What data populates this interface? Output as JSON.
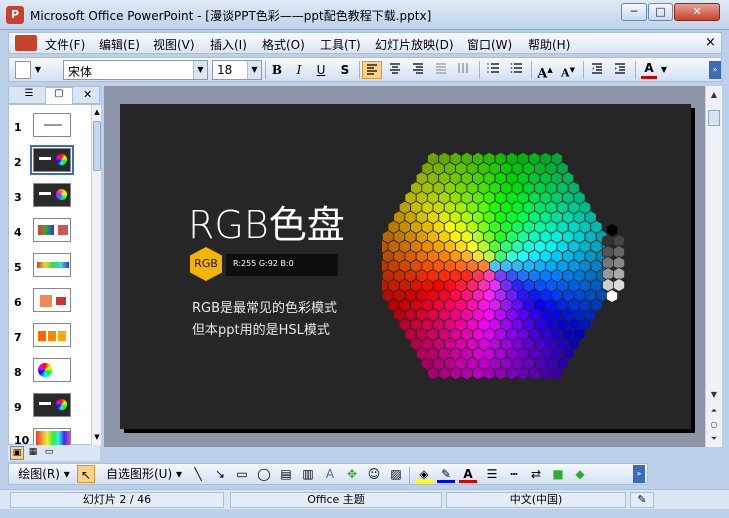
{
  "window": {
    "app_icon": "P",
    "title": "Microsoft Office PowerPoint - [漫谈PPT色彩——ppt配色教程下载.pptx]",
    "min": "─",
    "max": "□",
    "close": "✕"
  },
  "menu": [
    "文件(F)",
    "编辑(E)",
    "视图(V)",
    "插入(I)",
    "格式(O)",
    "工具(T)",
    "幻灯片放映(D)",
    "窗口(W)",
    "帮助(H)"
  ],
  "menu_close": "×",
  "toolbar": {
    "font_name": "宋体",
    "font_size": "18",
    "dropdown": "▼",
    "bold": "B",
    "italic": "I",
    "underline": "U",
    "shadow": "S",
    "font_color_label": "A"
  },
  "thumbnails": {
    "numbers": [
      "1",
      "2",
      "3",
      "4",
      "5",
      "6",
      "7",
      "8",
      "9",
      "10"
    ],
    "selected": "2"
  },
  "slide": {
    "title": "RGB色盘",
    "badge": "RGB",
    "values": "R:255  G:92  B:0",
    "line1": "RGB是最常见的色彩模式",
    "line2": "但本ppt用的是HSL模式"
  },
  "drawbar": {
    "draw": "绘图(R) ▾",
    "autoshape": "自选图形(U) ▾"
  },
  "status": {
    "slide_pos": "幻灯片 2 / 46",
    "theme": "Office 主题",
    "language": "中文(中国)"
  },
  "colors": {
    "accent": "#f5b400",
    "slide_bg": "#262626",
    "chrome": "#bcd0ea"
  }
}
